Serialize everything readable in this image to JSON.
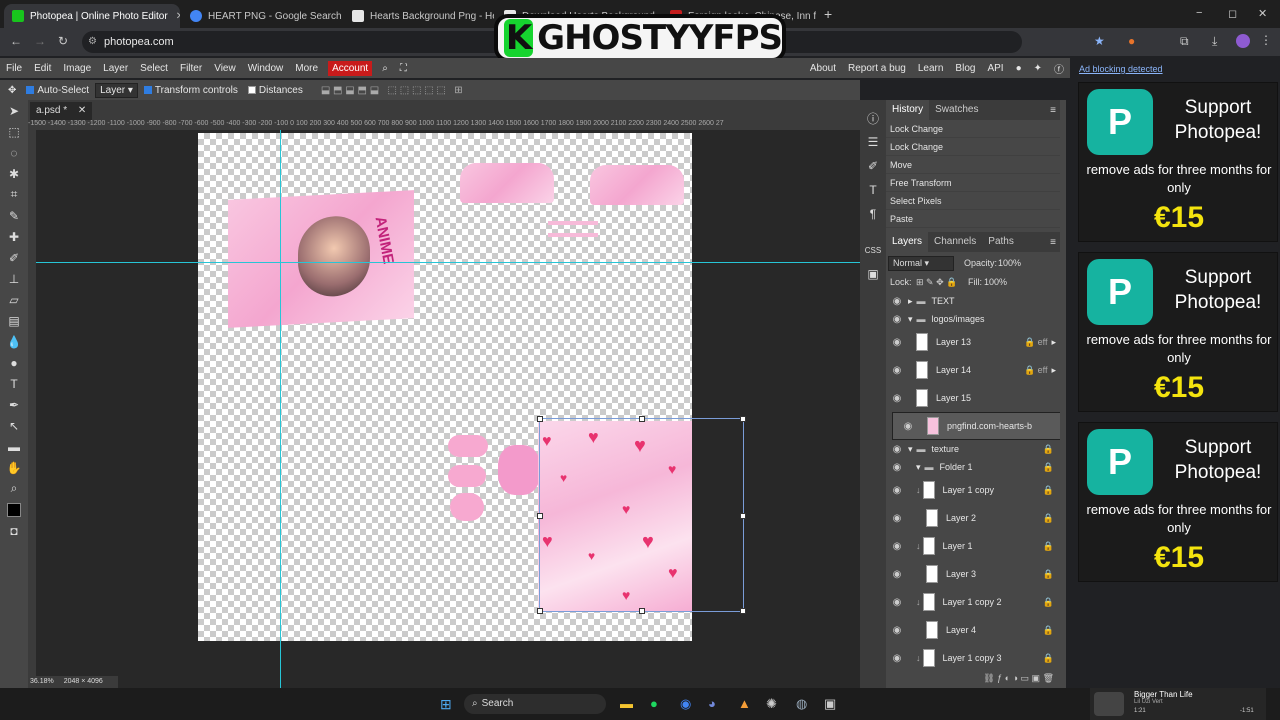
{
  "browser": {
    "tabs": [
      {
        "title": "Photopea | Online Photo Editor",
        "active": true,
        "favicon_color": "#18c41d"
      },
      {
        "title": "HEART PNG - Google Search",
        "active": false,
        "favicon_color": "#4285f4"
      },
      {
        "title": "Hearts Background Png - Heart",
        "active": false,
        "favicon_color": "#e6e6e6"
      },
      {
        "title": "Download Hearts Background",
        "active": false,
        "favicon_color": "#e6e6e6"
      },
      {
        "title": "Foreign look > Chinese, Inn for",
        "active": false,
        "favicon_color": "#c41d1d"
      }
    ],
    "new_tab": "+",
    "url": "photopea.com",
    "window_controls": {
      "minimize": "−",
      "maximize": "◻",
      "close": "✕"
    }
  },
  "watermark": {
    "letter": "K",
    "text": "GHOSTYYFPS"
  },
  "menubar": {
    "items": [
      "File",
      "Edit",
      "Image",
      "Layer",
      "Select",
      "Filter",
      "View",
      "Window",
      "More"
    ],
    "account": "Account",
    "right_links": [
      "About",
      "Report a bug",
      "Learn",
      "Blog",
      "API"
    ]
  },
  "options": {
    "auto_select": "Auto-Select",
    "layer_select": "Layer",
    "transform_controls": "Transform controls",
    "distances": "Distances"
  },
  "document": {
    "tab_name": "a.psd *",
    "ruler_labels": "-1500 -1400 -1300 -1200 -1100 -1000 -900 -800 -700 -600 -500 -400 -300 -200 -100 0 100 200 300 400 500 600 700 800 900 1000 1100 1200 1300 1400 1500 1600 1700 1800 1900 2000 2100 2200 2300 2400 2500 2600 27",
    "zoom": "36.18%",
    "size": "2048 × 4096",
    "art_text": "ANIME"
  },
  "history": {
    "tabs": [
      "History",
      "Swatches"
    ],
    "items": [
      "Lock Change",
      "Lock Change",
      "Move",
      "Free Transform",
      "Select Pixels",
      "Paste"
    ]
  },
  "layers": {
    "tabs": [
      "Layers",
      "Channels",
      "Paths"
    ],
    "blend_mode": "Normal",
    "opacity_label": "Opacity:",
    "opacity": "100%",
    "lock_label": "Lock:",
    "fill_label": "Fill:",
    "fill": "100%",
    "rows": [
      {
        "name": "TEXT",
        "type": "folder",
        "locked": false,
        "eff": false
      },
      {
        "name": "logos/images",
        "type": "folder-open",
        "locked": false,
        "eff": false
      },
      {
        "name": "Layer 13",
        "type": "layer",
        "locked": true,
        "eff": true
      },
      {
        "name": "Layer 14",
        "type": "layer",
        "locked": true,
        "eff": true
      },
      {
        "name": "Layer 15",
        "type": "layer",
        "locked": false,
        "eff": false
      },
      {
        "name": "pngfind.com-hearts-b",
        "type": "layer",
        "locked": false,
        "eff": false,
        "selected": true
      },
      {
        "name": "texture",
        "type": "folder-open",
        "locked": true,
        "eff": false
      },
      {
        "name": "Folder 1",
        "type": "folder-open",
        "locked": true,
        "eff": false
      },
      {
        "name": "Layer 1 copy",
        "type": "layer",
        "locked": true,
        "eff": false
      },
      {
        "name": "Layer 2",
        "type": "layer",
        "locked": true,
        "eff": false
      },
      {
        "name": "Layer 1",
        "type": "layer",
        "locked": true,
        "eff": false
      },
      {
        "name": "Layer 3",
        "type": "layer",
        "locked": true,
        "eff": false
      },
      {
        "name": "Layer 1 copy 2",
        "type": "layer",
        "locked": true,
        "eff": false
      },
      {
        "name": "Layer 4",
        "type": "layer",
        "locked": true,
        "eff": false
      },
      {
        "name": "Layer 1 copy 3",
        "type": "layer",
        "locked": true,
        "eff": false
      }
    ],
    "eff_label": "eff"
  },
  "ads": {
    "notice": "Ad blocking detected",
    "title": "Support Photopea!",
    "subtitle": "remove ads for three months for only",
    "price": "€15"
  },
  "taskbar": {
    "search": "Search",
    "media_title": "Bigger Than Life",
    "media_artist": "Lil Uzi Vert",
    "media_pos": "1:21",
    "media_remaining": "-1:51"
  },
  "colors": {
    "accent": "#2f7de1",
    "account_red": "#c81b1b",
    "guide": "#27c5d6",
    "ad_teal": "#16b3a0",
    "price_yellow": "#f4e40e"
  }
}
